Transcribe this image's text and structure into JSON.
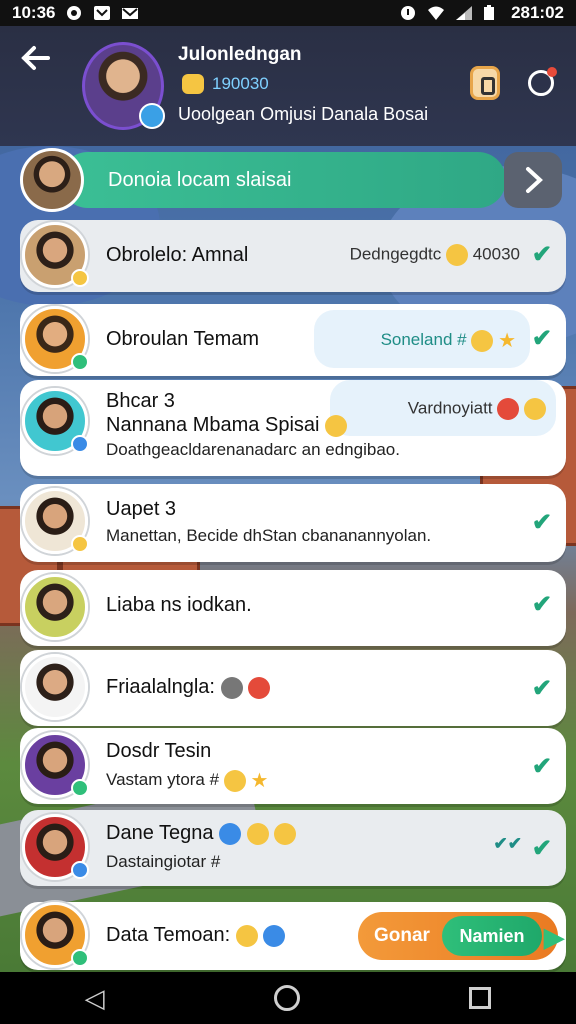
{
  "status_bar": {
    "time_left": "10:36",
    "time_right": "281:02"
  },
  "header": {
    "name": "Julonledngan",
    "id": "190030",
    "status": "Uoolgean Omjusi Danala Bosai"
  },
  "search": {
    "placeholder": "Donoia locam slaisai"
  },
  "items": [
    {
      "name": "Obrolelo: Amnal",
      "meta": "Dedngegdtc",
      "meta_num": "40030"
    },
    {
      "name": "Obroulan Temam",
      "meta": "Soneland #"
    },
    {
      "name": "Bhcar 3",
      "name2": "Nannana Mbama Spisai",
      "sub": "Doathgeacldarenanadarc an edngibao.",
      "meta": "Vardnoyiatt"
    },
    {
      "name": "Uapet 3",
      "sub": "Manettan, Becide dhStan cbananannyolan."
    },
    {
      "name": "Liaba ns iodkan."
    },
    {
      "name": "Friaalalngla:"
    },
    {
      "name": "Dosdr Tesin",
      "sub": "Vastam ytora #"
    },
    {
      "name": "Dane Tegna",
      "sub": "Dastaingiotar #"
    },
    {
      "name": "Data Temoan:"
    }
  ],
  "cta": {
    "left_label": "Gonar",
    "right_label": "Namien"
  },
  "icons": {
    "back": "back-arrow-icon",
    "search_go": "chevron-right-icon",
    "check": "check-icon"
  },
  "colors": {
    "accent_teal": "#3bbf95",
    "check_green": "#22a57a",
    "cta_orange": "#f39a3a"
  }
}
